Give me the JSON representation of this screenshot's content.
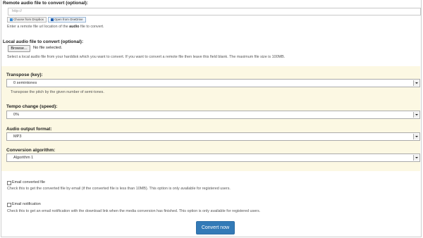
{
  "remote": {
    "label": "Remote audio file to convert (optional):",
    "placeholder": "http://",
    "dropbox_button": "Choose from Dropbox",
    "onedrive_button": "Open from OneDrive",
    "help_pre": "Enter a remote file url location of the ",
    "help_bold": "audio",
    "help_post": " file to convert."
  },
  "local": {
    "label": "Local audio file to convert (optional):",
    "browse_button": "Browse...",
    "file_status": "No file selected.",
    "help": "Select a local audio file from your harddisk which you want to convert. If you want to convert a remote file then leave this field blank. The maximum file size is 100MB."
  },
  "options": {
    "transpose": {
      "label": "Transpose (key):",
      "value": "0 semintones",
      "help": "Transpose the pitch by the given number of semi-tones."
    },
    "tempo": {
      "label": "Tempo change (speed):",
      "value": "0%"
    },
    "format": {
      "label": "Audio output format:",
      "value": "MP3"
    },
    "algorithm": {
      "label": "Conversion algorithm:",
      "value": "Algorithm 1"
    }
  },
  "email": {
    "label": "Email converted file",
    "help": "Check this to get the converted file by email (if the converted file is less than 10MB). This option is only available for registered users."
  },
  "notify": {
    "label": "Email notification",
    "help": "Check this to get an email notification with the download link when the media conversion has finished. This option is only available for registered users."
  },
  "convert_button": "Convert now",
  "colors": {
    "panel_bg": "#fcf8e3",
    "primary": "#337ab7"
  }
}
